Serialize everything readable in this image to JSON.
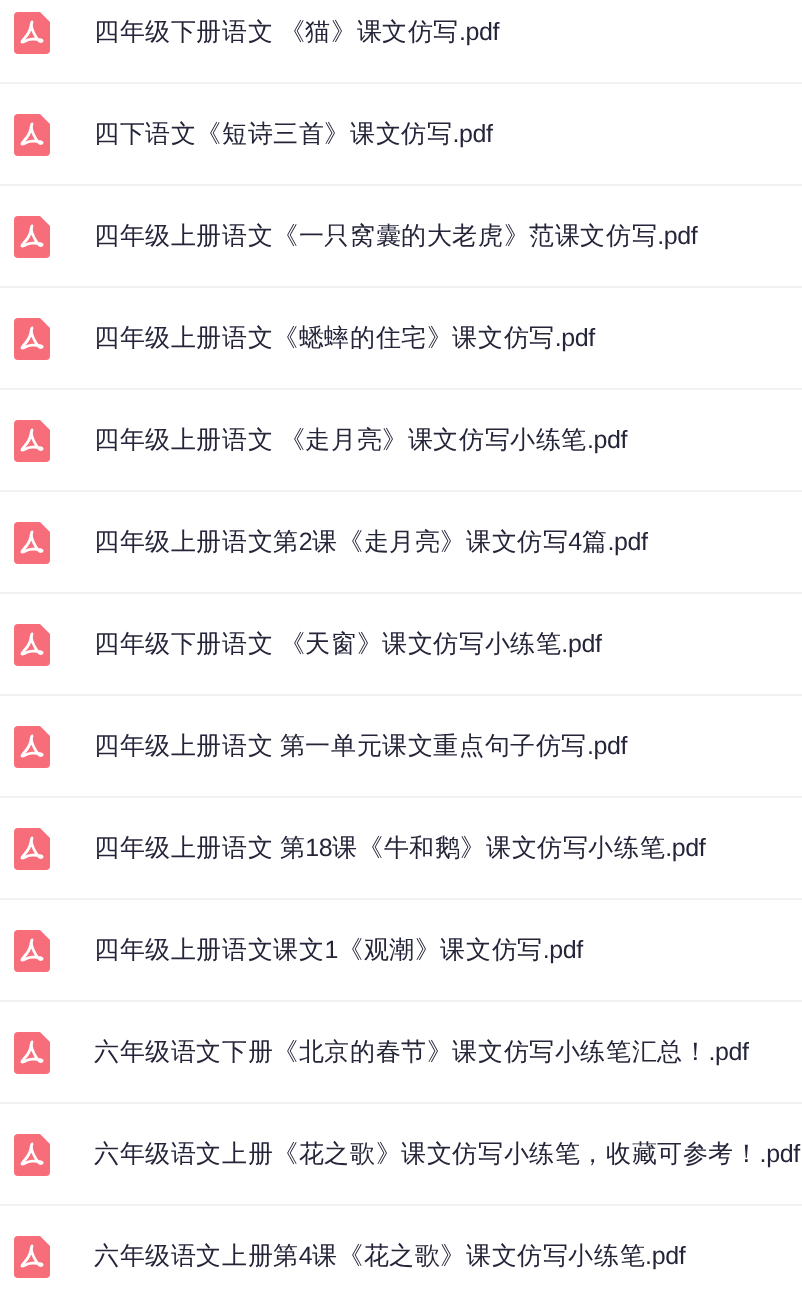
{
  "files": [
    {
      "name": "四年级下册语文 《猫》课文仿写.pdf"
    },
    {
      "name": "四下语文《短诗三首》课文仿写.pdf"
    },
    {
      "name": "四年级上册语文《一只窝囊的大老虎》范课文仿写.pdf"
    },
    {
      "name": "四年级上册语文《蟋蟀的住宅》课文仿写.pdf"
    },
    {
      "name": "四年级上册语文 《走月亮》课文仿写小练笔.pdf"
    },
    {
      "name": "四年级上册语文第2课《走月亮》课文仿写4篇.pdf"
    },
    {
      "name": "四年级下册语文 《天窗》课文仿写小练笔.pdf"
    },
    {
      "name": "四年级上册语文 第一单元课文重点句子仿写.pdf"
    },
    {
      "name": "四年级上册语文 第18课《牛和鹅》课文仿写小练笔.pdf"
    },
    {
      "name": "四年级上册语文课文1《观潮》课文仿写.pdf"
    },
    {
      "name": "六年级语文下册《北京的春节》课文仿写小练笔汇总！.pdf"
    },
    {
      "name": "六年级语文上册《花之歌》课文仿写小练笔，收藏可参考！.pdf"
    },
    {
      "name": "六年级语文上册第4课《花之歌》课文仿写小练笔.pdf"
    }
  ]
}
